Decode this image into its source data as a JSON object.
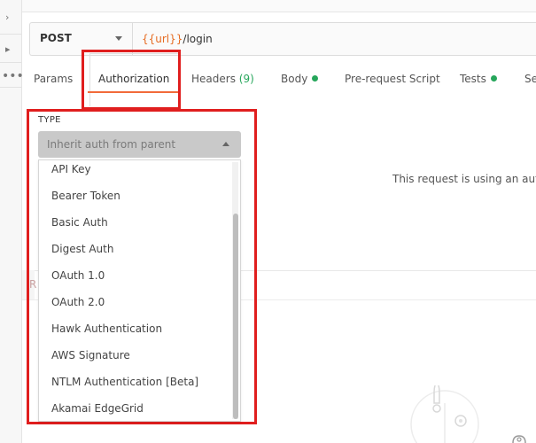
{
  "url_bar": {
    "method": "POST",
    "url_variable": "{{url}}",
    "url_path": "/login"
  },
  "tabs": [
    {
      "label": "Params"
    },
    {
      "label": "Authorization"
    },
    {
      "label": "Headers",
      "count": "(9)"
    },
    {
      "label": "Body"
    },
    {
      "label": "Pre-request Script"
    },
    {
      "label": "Tests"
    },
    {
      "label": "Se"
    }
  ],
  "auth": {
    "type_label": "TYPE",
    "selected": "Inherit auth from parent",
    "options": [
      "API Key",
      "Bearer Token",
      "Basic Auth",
      "Digest Auth",
      "OAuth 1.0",
      "OAuth 2.0",
      "Hawk Authentication",
      "AWS Signature",
      "NTLM Authentication [Beta]",
      "Akamai EdgeGrid"
    ]
  },
  "right_panel": {
    "message": "This request is using an autho"
  },
  "response_panel": {
    "partial_label": "R"
  },
  "colors": {
    "accent_orange": "#f26b3a",
    "url_variable": "#e66b21",
    "status_green": "#26a65b",
    "highlight_red": "#e01e1e"
  }
}
